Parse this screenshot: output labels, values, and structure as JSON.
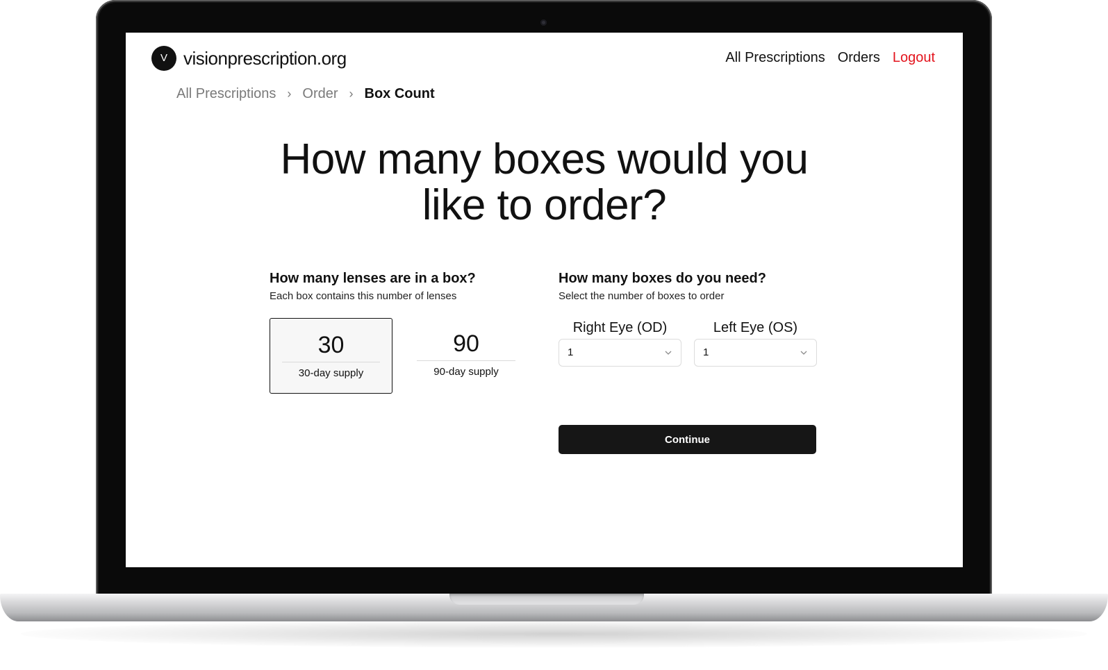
{
  "site": {
    "logo_letter": "V",
    "name": "visionprescription.org"
  },
  "nav": {
    "all_prescriptions": "All Prescriptions",
    "orders": "Orders",
    "logout": "Logout"
  },
  "colors": {
    "logout": "#e3141d",
    "continue_bg": "#161616"
  },
  "breadcrumb": {
    "items": [
      "All Prescriptions",
      "Order",
      "Box Count"
    ],
    "separator": "›"
  },
  "headline": {
    "line1": "How many boxes would you",
    "line2": "like to order?"
  },
  "lenses": {
    "title": "How many lenses are in a box?",
    "subtitle": "Each box contains this number of lenses",
    "options": [
      {
        "value": "30",
        "label": "30-day supply",
        "selected": true
      },
      {
        "value": "90",
        "label": "90-day supply",
        "selected": false
      }
    ]
  },
  "boxes": {
    "title": "How many boxes do you need?",
    "subtitle": "Select the number of boxes to order",
    "right_eye": {
      "label": "Right Eye (OD)",
      "value": "1"
    },
    "left_eye": {
      "label": "Left Eye (OS)",
      "value": "1"
    },
    "continue_label": "Continue"
  }
}
